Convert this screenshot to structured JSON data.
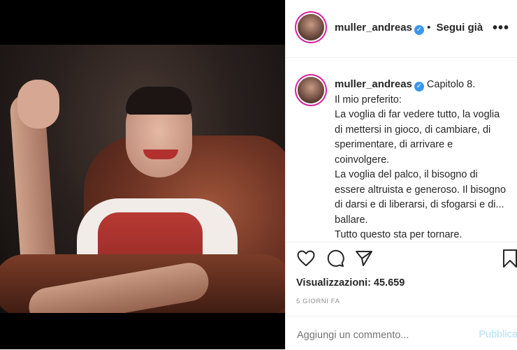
{
  "post": {
    "username": "muller_andreas",
    "follow_separator": "•",
    "follow_label": "Segui già",
    "more_label": "•••",
    "verified_icon": "verified-badge-icon"
  },
  "caption": {
    "username": "muller_andreas",
    "lines": [
      "Capitolo 8.",
      "Il mio preferito:",
      "La voglia di far vedere tutto, la voglia",
      "di mettersi in gioco, di cambiare, di",
      "sperimentare, di arrivare e",
      "coinvolgere.",
      "La voglia del palco, il bisogno di",
      "essere altruista e generoso. Il bisogno",
      "di darsi e di liberarsi, di sfogarsi e di...",
      "ballare.",
      "Tutto questo sta per tornare."
    ]
  },
  "actions": {
    "like_icon": "heart-icon",
    "comment_icon": "comment-icon",
    "share_icon": "send-icon",
    "save_icon": "bookmark-icon"
  },
  "stats": {
    "views": "Visualizzazioni: 45.659",
    "time": "5 GIORNI FA"
  },
  "comment": {
    "placeholder": "Aggiungi un commento...",
    "publish_label": "Pubblica"
  },
  "colors": {
    "accent": "#3897f0",
    "publish_disabled": "#b2dffc",
    "text": "#262626",
    "muted": "#8e8e8e"
  }
}
